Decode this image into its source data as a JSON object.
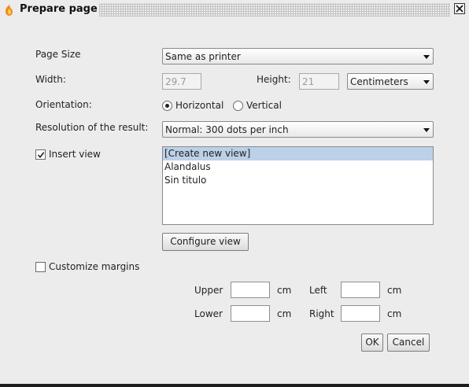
{
  "window": {
    "title": "Prepare page",
    "close_icon": "close-icon"
  },
  "page_size": {
    "label": "Page Size",
    "value": "Same as printer"
  },
  "width": {
    "label": "Width:",
    "value": "29.7"
  },
  "height": {
    "label": "Height:",
    "value": "21"
  },
  "units": {
    "value": "Centimeters"
  },
  "orientation": {
    "label": "Orientation:",
    "horizontal": "Horizontal",
    "vertical": "Vertical",
    "selected": "Horizontal"
  },
  "resolution": {
    "label": "Resolution of the result:",
    "value": "Normal: 300 dots per inch"
  },
  "insert_view": {
    "label": "Insert view",
    "checked": true
  },
  "views": [
    "[Create new view]",
    "Alandalus",
    "Sin titulo"
  ],
  "configure_view": {
    "label": "Configure view"
  },
  "margins": {
    "label": "Customize margins",
    "checked": false,
    "upper": "Upper",
    "lower": "Lower",
    "left": "Left",
    "right": "Right",
    "unit": "cm"
  },
  "buttons": {
    "ok": "OK",
    "cancel": "Cancel"
  },
  "colors": {
    "selection": "#bcd1e8",
    "background": "#ececec"
  }
}
